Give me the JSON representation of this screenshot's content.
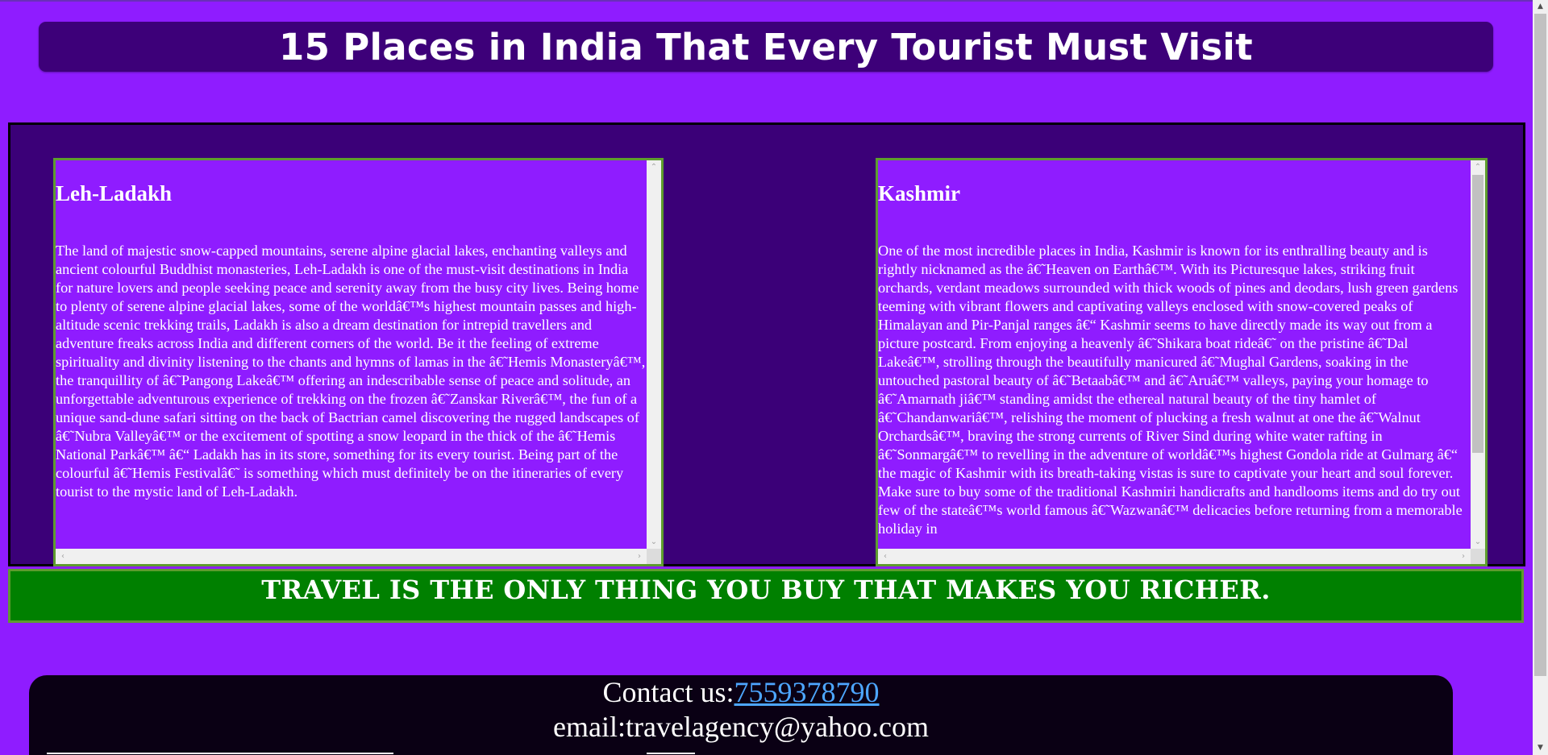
{
  "page": {
    "title": "15 Places in India That Every Tourist Must Visit"
  },
  "cards": [
    {
      "heading": "Leh-Ladakh",
      "text": "The land of majestic snow-capped mountains, serene alpine glacial lakes, enchanting valleys and ancient colourful Buddhist monasteries, Leh-Ladakh is one of the must-visit destinations in India for nature lovers and people seeking peace and serenity away from the busy city lives. Being home to plenty of serene alpine glacial lakes, some of the worldâ€™s highest mountain passes and high-altitude scenic trekking trails, Ladakh is also a dream destination for intrepid travellers and adventure freaks across India and different corners of the world. Be it the feeling of extreme spirituality and divinity listening to the chants and hymns of lamas in the â€˜Hemis Monasteryâ€™, the tranquillity of â€˜Pangong Lakeâ€™ offering an indescribable sense of peace and solitude, an unforgettable adventurous experience of trekking on the frozen â€˜Zanskar Riverâ€™, the fun of a unique sand-dune safari sitting on the back of Bactrian camel discovering the rugged landscapes of â€˜Nubra Valleyâ€™ or the excitement of spotting a snow leopard in the thick of the â€˜Hemis National Parkâ€™ â€“ Ladakh has in its store, something for its every tourist. Being part of the colourful â€˜Hemis Festivalâ€˜ is something which must definitely be on the itineraries of every tourist to the mystic land of Leh-Ladakh."
    },
    {
      "heading": "Kashmir",
      "text": "One of the most incredible places in India, Kashmir is known for its enthralling beauty and is rightly nicknamed as the â€˜Heaven on Earthâ€™. With its Picturesque lakes, striking fruit orchards, verdant meadows surrounded with thick woods of pines and deodars, lush green gardens teeming with vibrant flowers and captivating valleys enclosed with snow-covered peaks of Himalayan and Pir-Panjal ranges â€“ Kashmir seems to have directly made its way out from a picture postcard. From enjoying a heavenly â€˜Shikara boat rideâ€˜ on the pristine â€˜Dal Lakeâ€™, strolling through the beautifully manicured â€˜Mughal Gardens, soaking in the untouched pastoral beauty of â€˜Betaabâ€™ and â€˜Aruâ€™ valleys, paying your homage to â€˜Amarnath jiâ€™ standing amidst the ethereal natural beauty of the tiny hamlet of â€˜Chandanwariâ€™, relishing the moment of plucking a fresh walnut at one the â€˜Walnut Orchardsâ€™, braving the strong currents of River Sind during white water rafting in â€˜Sonmargâ€™ to revelling in the adventure of worldâ€™s highest Gondola ride at Gulmarg â€“ the magic of Kashmir with its breath-taking vistas is sure to captivate your heart and soul forever. Make sure to buy some of the traditional Kashmiri handicrafts and handlooms items and do try out few of the stateâ€™s world famous â€˜Wazwanâ€™ delicacies before returning from a memorable holiday in"
    }
  ],
  "quote": "TRAVEL IS THE ONLY THING YOU BUY THAT MAKES YOU RICHER.",
  "footer": {
    "contact_label": "Contact us:",
    "phone": "7559378790",
    "email_line": "email:travelagency@yahoo.com"
  },
  "icons": {
    "scroll_up": "up-arrow-icon",
    "scroll_down": "down-arrow-icon",
    "scroll_left": "left-arrow-icon",
    "scroll_right": "right-arrow-icon"
  },
  "colors": {
    "background": "#8f1cff",
    "title_bar": "#3d0079",
    "panel": "#3b0078",
    "card_border": "#5e9c2e",
    "quote_bar": "#008000",
    "footer": "#0a0014",
    "link": "#4da6ff"
  }
}
